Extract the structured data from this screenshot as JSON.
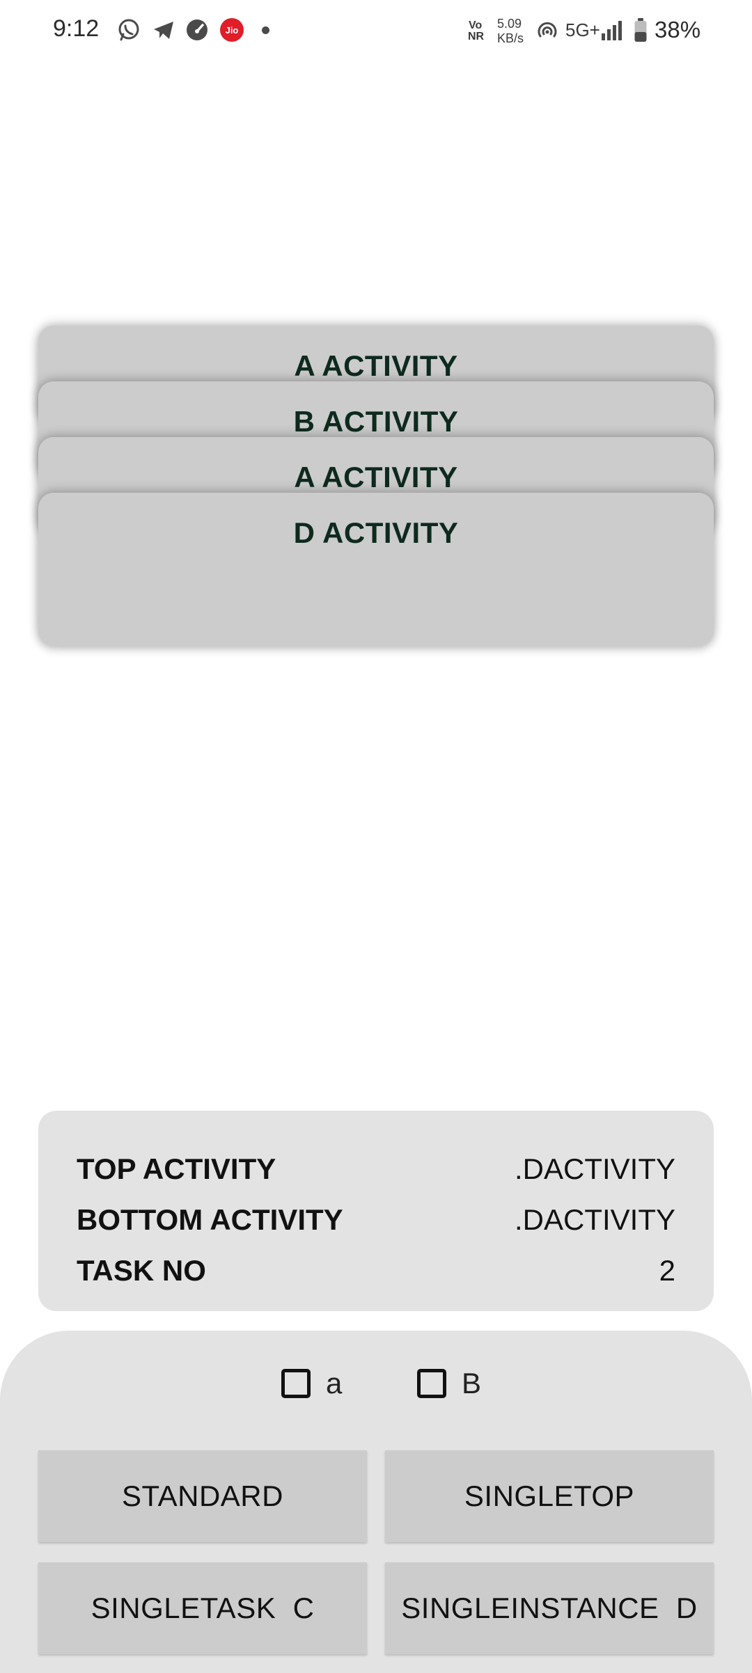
{
  "status_bar": {
    "time": "9:12",
    "notification_icons": [
      "whatsapp-icon",
      "telegram-icon",
      "speedometer-icon",
      "jio-icon",
      "dot-icon"
    ],
    "jio_label": "Jio",
    "volte_top": "Vo",
    "volte_bottom": "NR",
    "speed_value": "5.09",
    "speed_unit": "KB/s",
    "network_label": "5G+",
    "battery_percent": "38%",
    "jio_color": "#e11d2a"
  },
  "activity_stack": {
    "cards": [
      {
        "label": "A ACTIVITY"
      },
      {
        "label": "B ACTIVITY"
      },
      {
        "label": "A ACTIVITY"
      },
      {
        "label": "D ACTIVITY"
      }
    ]
  },
  "info_panel": {
    "top_activity_label": "TOP ACTIVITY",
    "top_activity_value": ".DACTIVITY",
    "bottom_activity_label": "BOTTOM ACTIVITY",
    "bottom_activity_value": ".DACTIVITY",
    "task_no_label": "TASK NO",
    "task_no_value": "2"
  },
  "controls": {
    "checkbox_a_label": "a",
    "checkbox_a_checked": false,
    "checkbox_b_label": "B",
    "checkbox_b_checked": false,
    "standard_label": "STANDARD",
    "singletop_label": "SINGLETOP",
    "singletask_label": "SINGLETASK  C",
    "singleinstance_label": "SINGLEINSTANCE  D"
  },
  "colors": {
    "card_background": "#cccccc",
    "card_text": "#0e2a1e",
    "panel_background": "#e3e3e3"
  }
}
